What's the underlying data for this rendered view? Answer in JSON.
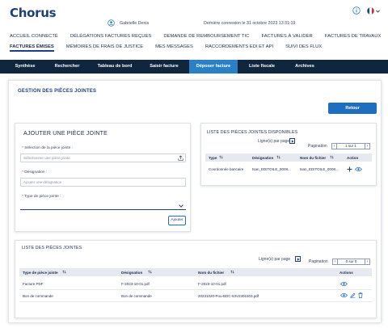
{
  "header": {
    "logo_text": "Chorus",
    "logo_sub": "Pro",
    "user_name": "Gabrielle Denis",
    "last_login": "Dernière connexion le 31 octobre 2023 13:31:19",
    "info_icon": "info-icon",
    "lang_icon": "french-flag-icon"
  },
  "nav": {
    "row1": [
      "Accueil connecté",
      "Délégations factures reçues",
      "Demande de remboursement TIC",
      "Factures à valider",
      "Factures de travaux"
    ],
    "row2": [
      "Factures émises",
      "Mémoires de frais de justice",
      "Mes messages",
      "Raccordements EDI et API",
      "Suivi des flux"
    ]
  },
  "tabs": [
    "Synthèse",
    "Rechercher",
    "Tableau de bord",
    "Saisir facture",
    "Déposer facture",
    "Liste fiscale",
    "Archives"
  ],
  "active_tab": "Déposer facture",
  "gestion": {
    "title": "Gestion des pièces jointes",
    "retour_label": "Retour"
  },
  "add_form": {
    "title": "Ajouter une pièce jointe",
    "select_label": "Sélection de la pièce jointe :",
    "select_placeholder": "Sélectionner une pièce jointe",
    "designation_label": "Désignation :",
    "designation_placeholder": "Ajouter une désignation",
    "type_label": "Type de pièce jointe :",
    "submit_label": "Ajouter"
  },
  "available": {
    "title": "Liste des pièces jointes disponibles",
    "per_page_label": "Ligne(s) par page",
    "pagination_label": "Pagination",
    "page_text": "1 sur 1",
    "columns": [
      "Type",
      "Désignation",
      "Nom du fichier",
      "Action"
    ],
    "rows": [
      {
        "type": "Coordonnée bancaire",
        "designation": "tsan_EDITOILE_0008...",
        "filename": "tsan_EDITOILE_0008..."
      }
    ]
  },
  "attached": {
    "title": "Liste des pièces jointes",
    "per_page_label": "Ligne(s) par page",
    "pagination_label": "Pagination",
    "page_text": "0 sur 0",
    "columns": [
      "Type de pièce jointe",
      "Désignation",
      "Nom du fichier",
      "Actions"
    ],
    "rows": [
      {
        "type": "Facture PDF",
        "designation": "F-2023-10-01.pdf",
        "filename": "F-2023-10-01.pdf"
      },
      {
        "type": "Bon de commande",
        "designation": "Bon de commande",
        "filename": "20231020-Pou-BDC-53V2301503.pdf"
      }
    ]
  },
  "colors": {
    "tab_bar": "#10263f",
    "tab_active": "#2b7fc4",
    "primary_button": "#1f6fc0",
    "title_blue": "#1f3f7a"
  }
}
